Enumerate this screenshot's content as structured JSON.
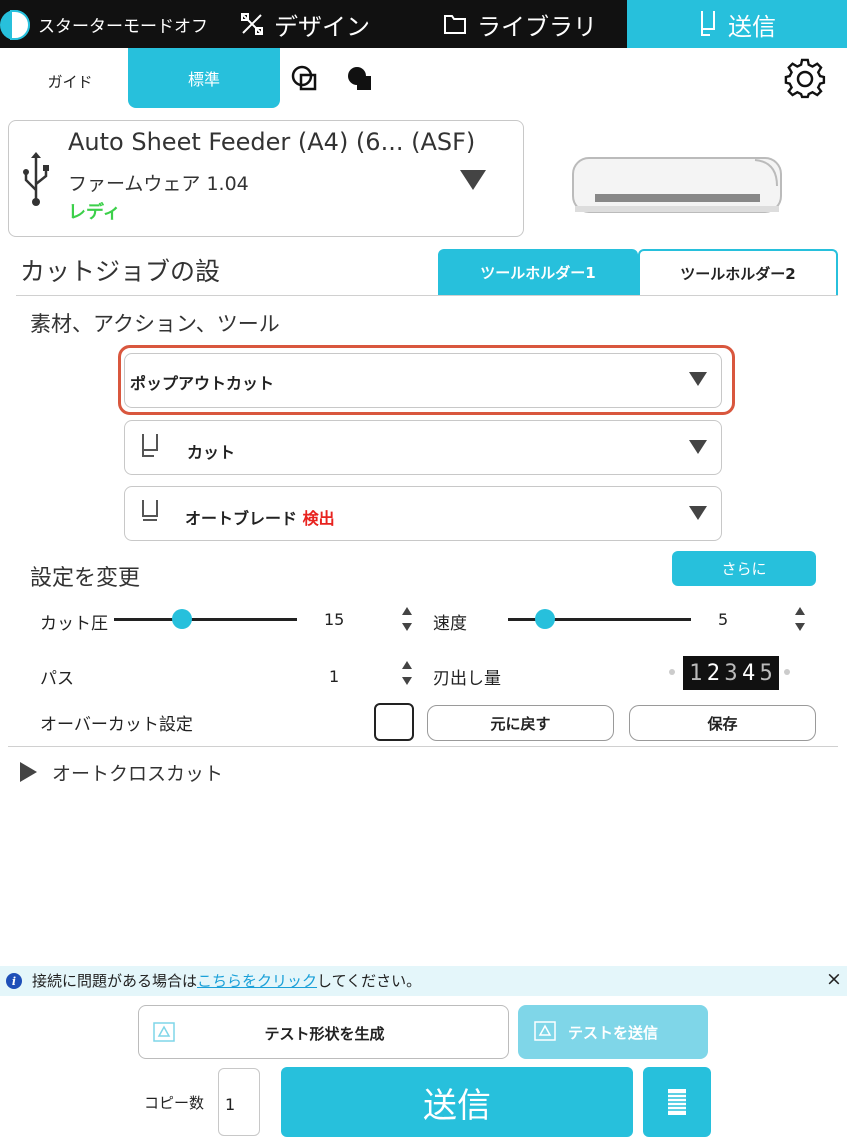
{
  "topbar": {
    "starter_mode": "スターターモードオフ",
    "tabs": [
      {
        "label": "デザイン",
        "icon": "design-icon"
      },
      {
        "label": "ライブラリ",
        "icon": "folder-icon"
      },
      {
        "label": "送信",
        "icon": "blade-holder-icon",
        "active": true
      }
    ]
  },
  "modes": {
    "guide": "ガイド",
    "standard": "標準",
    "active": "standard"
  },
  "device": {
    "name": "Auto Sheet Feeder (A4) (6... (ASF)",
    "firmware": "ファームウェア 1.04",
    "status": "レディ",
    "status_color": "#3cd04a"
  },
  "job": {
    "title": "カットジョブの設",
    "holders": [
      "ツールホルダー1",
      "ツールホルダー2"
    ],
    "active_holder": 0,
    "section_label": "素材、アクション、ツール",
    "material": "ポップアウトカット",
    "action": "カット",
    "tool": "オートブレード",
    "tool_status": "検出"
  },
  "settings": {
    "label": "設定を変更",
    "more": "さらに",
    "force_label": "カット圧",
    "force_value": "15",
    "force_fraction": 0.37,
    "speed_label": "速度",
    "speed_value": "5",
    "speed_fraction": 0.2,
    "passes_label": "パス",
    "passes_value": "1",
    "blade_depth_label": "刃出し量",
    "blade_depth_digits": [
      "1",
      "2",
      "3",
      "4",
      "5"
    ],
    "overcut_label": "オーバーカット設定",
    "overcut_checked": false,
    "reset": "元に戻す",
    "save": "保存",
    "autocross": "オートクロスカット"
  },
  "notice": {
    "prefix": "接続に問題がある場合は",
    "link": "こちらをクリック",
    "suffix": "してください。",
    "close": "×"
  },
  "bottom": {
    "test_shape": "テスト形状を生成",
    "test_send": "テストを送信",
    "copies_label": "コピー数",
    "copies_value": "1",
    "send": "送信"
  },
  "colors": {
    "accent": "#27c0dc",
    "highlight": "#d9573e",
    "detect": "#e8231f",
    "link": "#1aa0d8"
  }
}
